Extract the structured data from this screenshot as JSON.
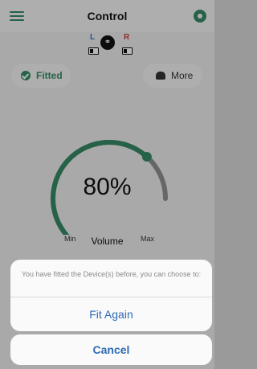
{
  "header": {
    "title": "Control"
  },
  "devices": {
    "left_label": "L",
    "right_label": "R"
  },
  "status": {
    "fitted_label": "Fitted",
    "more_label": "More"
  },
  "volume": {
    "percent_text": "80%",
    "level": 0.8,
    "min_label": "Min",
    "max_label": "Max",
    "label": "Volume"
  },
  "colors": {
    "accent": "#2e8a62",
    "inactive_arc": "#8e8e8e",
    "action_blue": "#2d6bb5"
  },
  "action_sheet": {
    "message": "You have fitted the Device(s) before, you can choose to:",
    "fit_again_label": "Fit Again",
    "cancel_label": "Cancel"
  }
}
